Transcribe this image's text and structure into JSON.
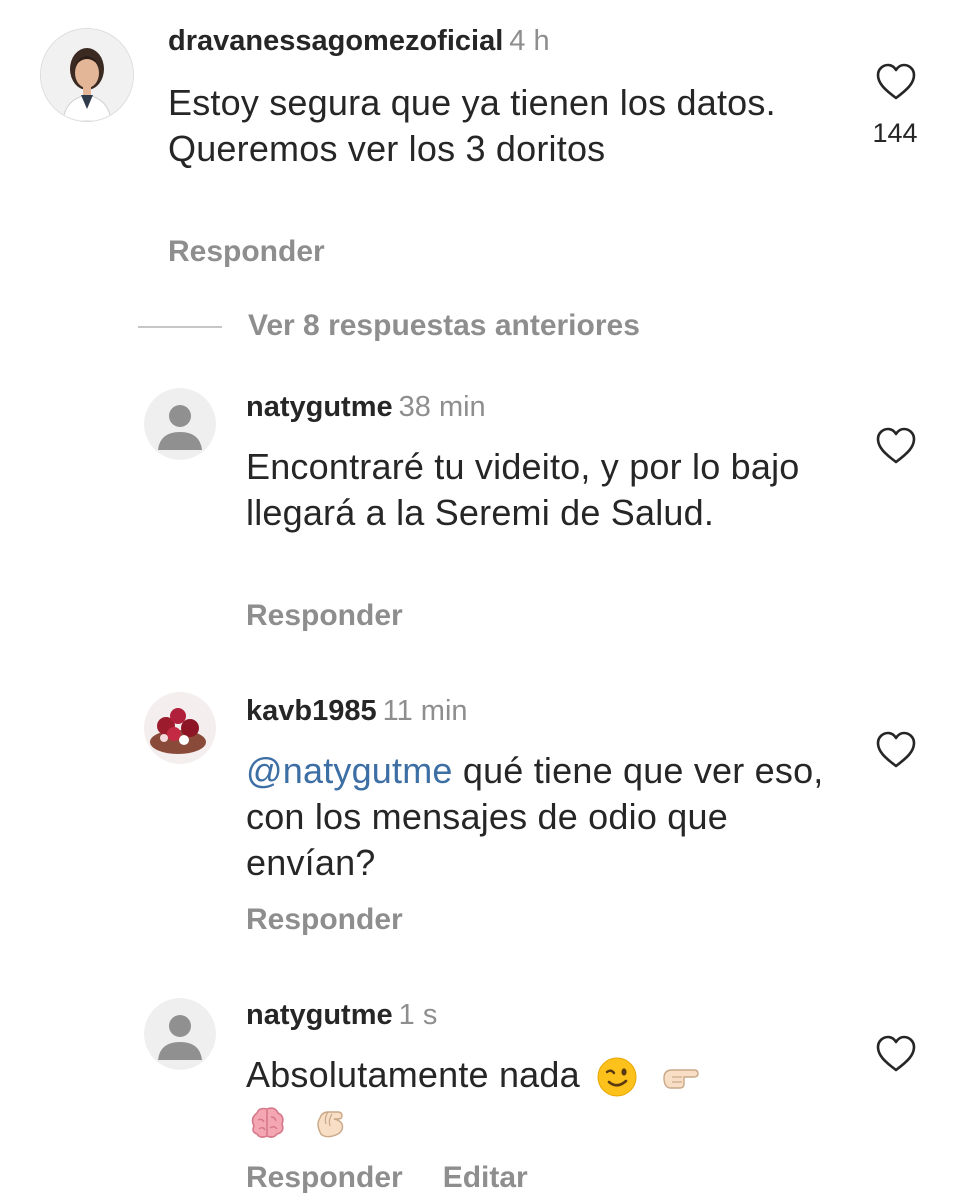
{
  "comments": [
    {
      "username": "dravanessagomezoficial",
      "time": "4 h",
      "text": "Estoy segura que ya tienen los datos. Queremos ver los 3 doritos",
      "reply_label": "Responder",
      "likes": "144",
      "avatar": "profile-photo-woman"
    },
    {
      "username": "natygutme",
      "time": "38 min",
      "text": "Encontraré tu videito, y por lo bajo llegará a la Seremi de Salud.",
      "reply_label": "Responder",
      "avatar": "default-user-icon"
    },
    {
      "username": "kavb1985",
      "time": "11 min",
      "mention": "@natygutme",
      "text": " qué tiene que ver eso, con los mensajes de odio que envían?",
      "reply_label": "Responder",
      "avatar": "profile-photo-berries"
    },
    {
      "username": "natygutme",
      "time": "1 s",
      "text": "Absolutamente nada",
      "emojis": [
        "winking-face",
        "backhand-index-pointing-right",
        "brain",
        "pinching-hand"
      ],
      "reply_label": "Responder",
      "edit_label": "Editar",
      "avatar": "default-user-icon"
    }
  ],
  "view_replies": "Ver 8 respuestas anteriores",
  "colors": {
    "text": "#262626",
    "secondary": "#8e8e8e",
    "mention": "#3d6fa5",
    "divider": "#c7c7c7"
  }
}
